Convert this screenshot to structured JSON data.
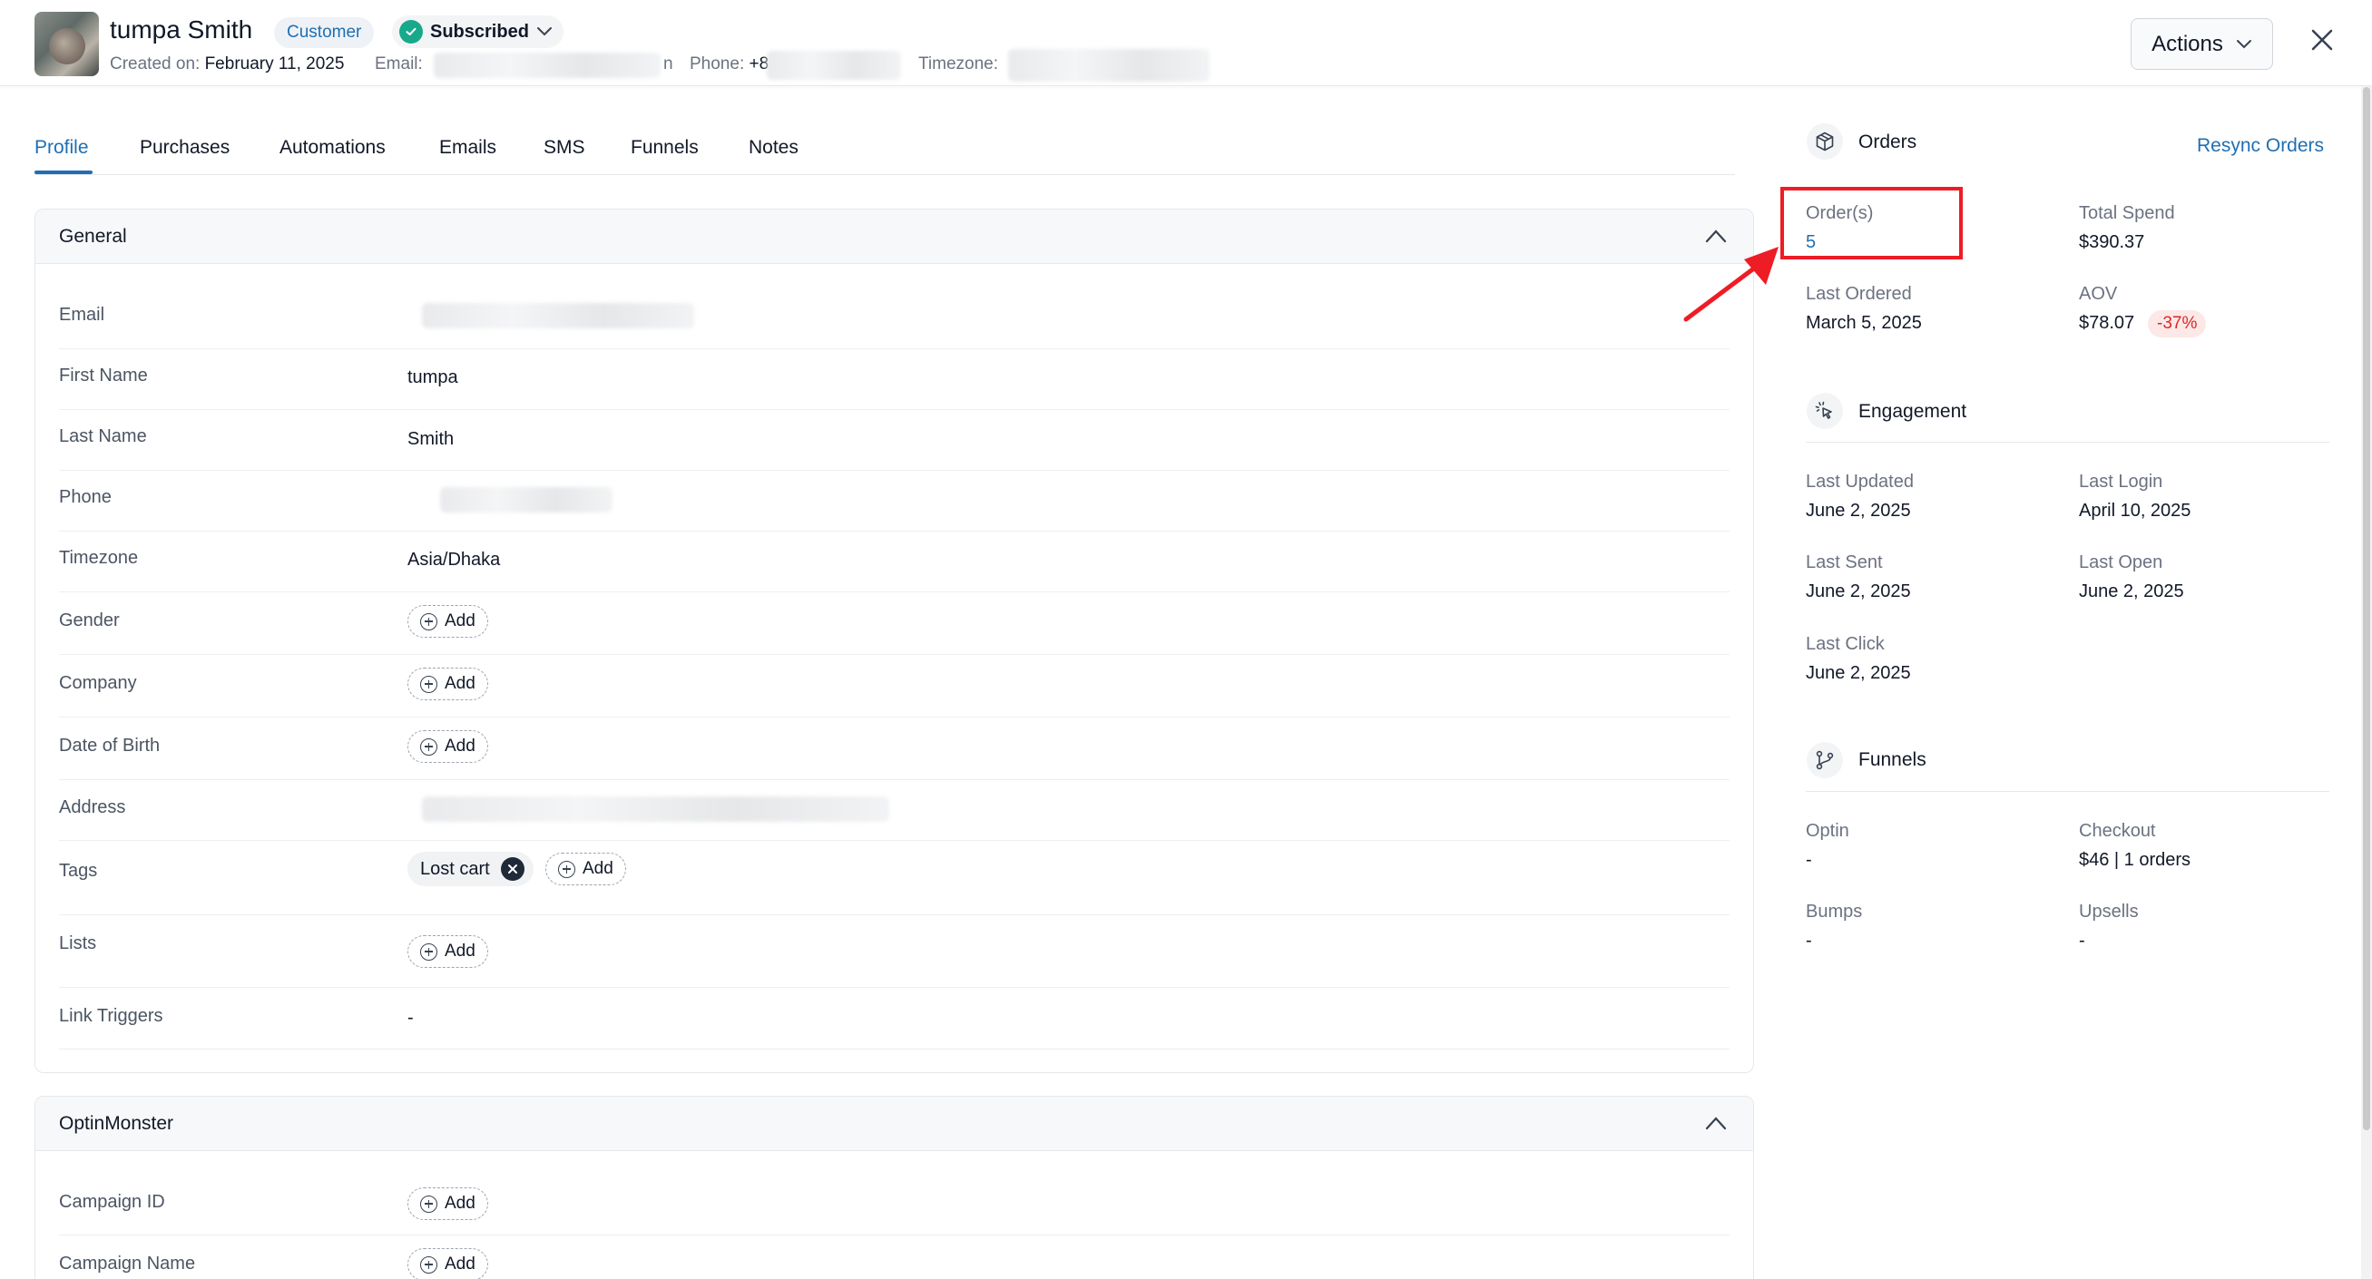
{
  "header": {
    "name": "tumpa Smith",
    "customer_badge": "Customer",
    "subscription_status": "Subscribed",
    "created_label": "Created on:",
    "created_value": "February 11, 2025",
    "email_label": "Email:",
    "email_tail": "n",
    "phone_label": "Phone:",
    "phone_prefix": "+8",
    "timezone_label": "Timezone:",
    "actions_label": "Actions"
  },
  "tabs": [
    "Profile",
    "Purchases",
    "Automations",
    "Emails",
    "SMS",
    "Funnels",
    "Notes"
  ],
  "general": {
    "title": "General",
    "fields": {
      "email": "Email",
      "first_name": "First Name",
      "first_name_value": "tumpa",
      "last_name": "Last Name",
      "last_name_value": "Smith",
      "phone": "Phone",
      "timezone": "Timezone",
      "timezone_value": "Asia/Dhaka",
      "gender": "Gender",
      "company": "Company",
      "dob": "Date of Birth",
      "address": "Address",
      "tags": "Tags",
      "lists": "Lists",
      "link_triggers": "Link Triggers",
      "link_triggers_value": "-"
    },
    "tag_value": "Lost cart",
    "add_label": "Add"
  },
  "optinmonster": {
    "title": "OptinMonster",
    "campaign_id": "Campaign ID",
    "campaign_name": "Campaign Name",
    "add_label": "Add"
  },
  "orders": {
    "title": "Orders",
    "resync": "Resync Orders",
    "orders_label": "Order(s)",
    "orders_value": "5",
    "total_spend_label": "Total Spend",
    "total_spend_value": "$390.37",
    "last_ordered_label": "Last Ordered",
    "last_ordered_value": "March 5, 2025",
    "aov_label": "AOV",
    "aov_value": "$78.07",
    "aov_change": "-37%"
  },
  "engagement": {
    "title": "Engagement",
    "last_updated_label": "Last Updated",
    "last_updated_value": "June 2, 2025",
    "last_login_label": "Last Login",
    "last_login_value": "April 10, 2025",
    "last_sent_label": "Last Sent",
    "last_sent_value": "June 2, 2025",
    "last_open_label": "Last Open",
    "last_open_value": "June 2, 2025",
    "last_click_label": "Last Click",
    "last_click_value": "June 2, 2025"
  },
  "funnels": {
    "title": "Funnels",
    "optin_label": "Optin",
    "optin_value": "-",
    "checkout_label": "Checkout",
    "checkout_value": "$46 | 1 orders",
    "bumps_label": "Bumps",
    "bumps_value": "-",
    "upsells_label": "Upsells",
    "upsells_value": "-"
  },
  "colors": {
    "accent": "#1f6fb2",
    "subscribed": "#18a98b",
    "annotation": "#ee1c25",
    "negative": "#dc2626"
  }
}
